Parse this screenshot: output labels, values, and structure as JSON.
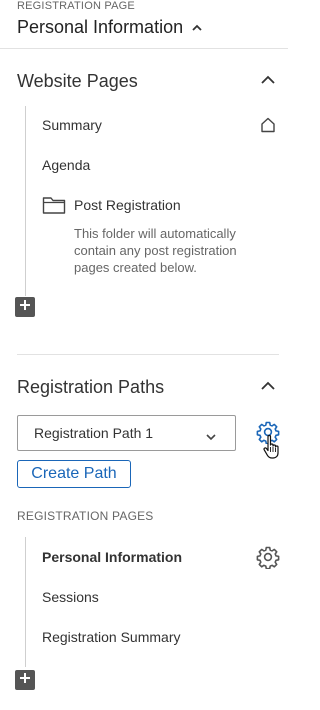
{
  "header": {
    "eyebrow": "REGISTRATION PAGE",
    "title": "Personal Information",
    "chevron_icon": "chevron-up-icon"
  },
  "website_pages": {
    "title": "Website Pages",
    "collapse_icon": "chevron-up-icon",
    "items": [
      {
        "label": "Summary",
        "icon": "home-icon"
      },
      {
        "label": "Agenda"
      }
    ],
    "folder": {
      "label": "Post Registration",
      "icon": "folder-icon",
      "description": "This folder will automatically contain any post registration pages created below."
    },
    "add_icon": "add-square-icon"
  },
  "registration_paths": {
    "title": "Registration Paths",
    "collapse_icon": "chevron-up-icon",
    "selected_path": "Registration Path 1",
    "settings_icon": "gear-icon",
    "create_label": "Create Path",
    "pages_heading": "REGISTRATION PAGES",
    "pages": [
      {
        "label": "Personal Information",
        "active": true,
        "icon": "gear-icon"
      },
      {
        "label": "Sessions"
      },
      {
        "label": "Registration Summary"
      }
    ],
    "add_icon": "add-square-icon"
  },
  "colors": {
    "accent": "#1a66b8",
    "text": "#333333",
    "muted": "#666666",
    "divider": "#e2e2e2"
  }
}
